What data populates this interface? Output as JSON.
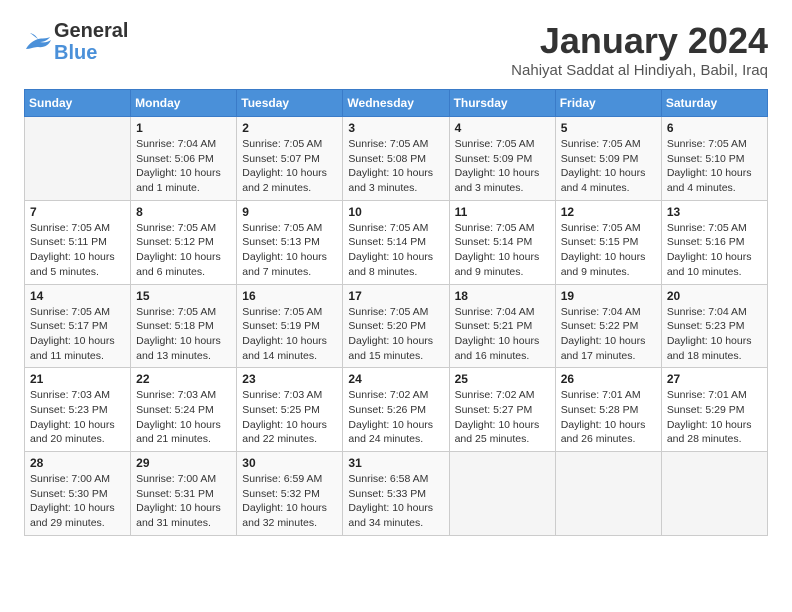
{
  "logo": {
    "line1": "General",
    "line2": "Blue"
  },
  "title": "January 2024",
  "subtitle": "Nahiyat Saddat al Hindiyah, Babil, Iraq",
  "headers": [
    "Sunday",
    "Monday",
    "Tuesday",
    "Wednesday",
    "Thursday",
    "Friday",
    "Saturday"
  ],
  "weeks": [
    [
      {
        "day": "",
        "info": ""
      },
      {
        "day": "1",
        "info": "Sunrise: 7:04 AM\nSunset: 5:06 PM\nDaylight: 10 hours\nand 1 minute."
      },
      {
        "day": "2",
        "info": "Sunrise: 7:05 AM\nSunset: 5:07 PM\nDaylight: 10 hours\nand 2 minutes."
      },
      {
        "day": "3",
        "info": "Sunrise: 7:05 AM\nSunset: 5:08 PM\nDaylight: 10 hours\nand 3 minutes."
      },
      {
        "day": "4",
        "info": "Sunrise: 7:05 AM\nSunset: 5:09 PM\nDaylight: 10 hours\nand 3 minutes."
      },
      {
        "day": "5",
        "info": "Sunrise: 7:05 AM\nSunset: 5:09 PM\nDaylight: 10 hours\nand 4 minutes."
      },
      {
        "day": "6",
        "info": "Sunrise: 7:05 AM\nSunset: 5:10 PM\nDaylight: 10 hours\nand 4 minutes."
      }
    ],
    [
      {
        "day": "7",
        "info": "Sunrise: 7:05 AM\nSunset: 5:11 PM\nDaylight: 10 hours\nand 5 minutes."
      },
      {
        "day": "8",
        "info": "Sunrise: 7:05 AM\nSunset: 5:12 PM\nDaylight: 10 hours\nand 6 minutes."
      },
      {
        "day": "9",
        "info": "Sunrise: 7:05 AM\nSunset: 5:13 PM\nDaylight: 10 hours\nand 7 minutes."
      },
      {
        "day": "10",
        "info": "Sunrise: 7:05 AM\nSunset: 5:14 PM\nDaylight: 10 hours\nand 8 minutes."
      },
      {
        "day": "11",
        "info": "Sunrise: 7:05 AM\nSunset: 5:14 PM\nDaylight: 10 hours\nand 9 minutes."
      },
      {
        "day": "12",
        "info": "Sunrise: 7:05 AM\nSunset: 5:15 PM\nDaylight: 10 hours\nand 9 minutes."
      },
      {
        "day": "13",
        "info": "Sunrise: 7:05 AM\nSunset: 5:16 PM\nDaylight: 10 hours\nand 10 minutes."
      }
    ],
    [
      {
        "day": "14",
        "info": "Sunrise: 7:05 AM\nSunset: 5:17 PM\nDaylight: 10 hours\nand 11 minutes."
      },
      {
        "day": "15",
        "info": "Sunrise: 7:05 AM\nSunset: 5:18 PM\nDaylight: 10 hours\nand 13 minutes."
      },
      {
        "day": "16",
        "info": "Sunrise: 7:05 AM\nSunset: 5:19 PM\nDaylight: 10 hours\nand 14 minutes."
      },
      {
        "day": "17",
        "info": "Sunrise: 7:05 AM\nSunset: 5:20 PM\nDaylight: 10 hours\nand 15 minutes."
      },
      {
        "day": "18",
        "info": "Sunrise: 7:04 AM\nSunset: 5:21 PM\nDaylight: 10 hours\nand 16 minutes."
      },
      {
        "day": "19",
        "info": "Sunrise: 7:04 AM\nSunset: 5:22 PM\nDaylight: 10 hours\nand 17 minutes."
      },
      {
        "day": "20",
        "info": "Sunrise: 7:04 AM\nSunset: 5:23 PM\nDaylight: 10 hours\nand 18 minutes."
      }
    ],
    [
      {
        "day": "21",
        "info": "Sunrise: 7:03 AM\nSunset: 5:23 PM\nDaylight: 10 hours\nand 20 minutes."
      },
      {
        "day": "22",
        "info": "Sunrise: 7:03 AM\nSunset: 5:24 PM\nDaylight: 10 hours\nand 21 minutes."
      },
      {
        "day": "23",
        "info": "Sunrise: 7:03 AM\nSunset: 5:25 PM\nDaylight: 10 hours\nand 22 minutes."
      },
      {
        "day": "24",
        "info": "Sunrise: 7:02 AM\nSunset: 5:26 PM\nDaylight: 10 hours\nand 24 minutes."
      },
      {
        "day": "25",
        "info": "Sunrise: 7:02 AM\nSunset: 5:27 PM\nDaylight: 10 hours\nand 25 minutes."
      },
      {
        "day": "26",
        "info": "Sunrise: 7:01 AM\nSunset: 5:28 PM\nDaylight: 10 hours\nand 26 minutes."
      },
      {
        "day": "27",
        "info": "Sunrise: 7:01 AM\nSunset: 5:29 PM\nDaylight: 10 hours\nand 28 minutes."
      }
    ],
    [
      {
        "day": "28",
        "info": "Sunrise: 7:00 AM\nSunset: 5:30 PM\nDaylight: 10 hours\nand 29 minutes."
      },
      {
        "day": "29",
        "info": "Sunrise: 7:00 AM\nSunset: 5:31 PM\nDaylight: 10 hours\nand 31 minutes."
      },
      {
        "day": "30",
        "info": "Sunrise: 6:59 AM\nSunset: 5:32 PM\nDaylight: 10 hours\nand 32 minutes."
      },
      {
        "day": "31",
        "info": "Sunrise: 6:58 AM\nSunset: 5:33 PM\nDaylight: 10 hours\nand 34 minutes."
      },
      {
        "day": "",
        "info": ""
      },
      {
        "day": "",
        "info": ""
      },
      {
        "day": "",
        "info": ""
      }
    ]
  ]
}
